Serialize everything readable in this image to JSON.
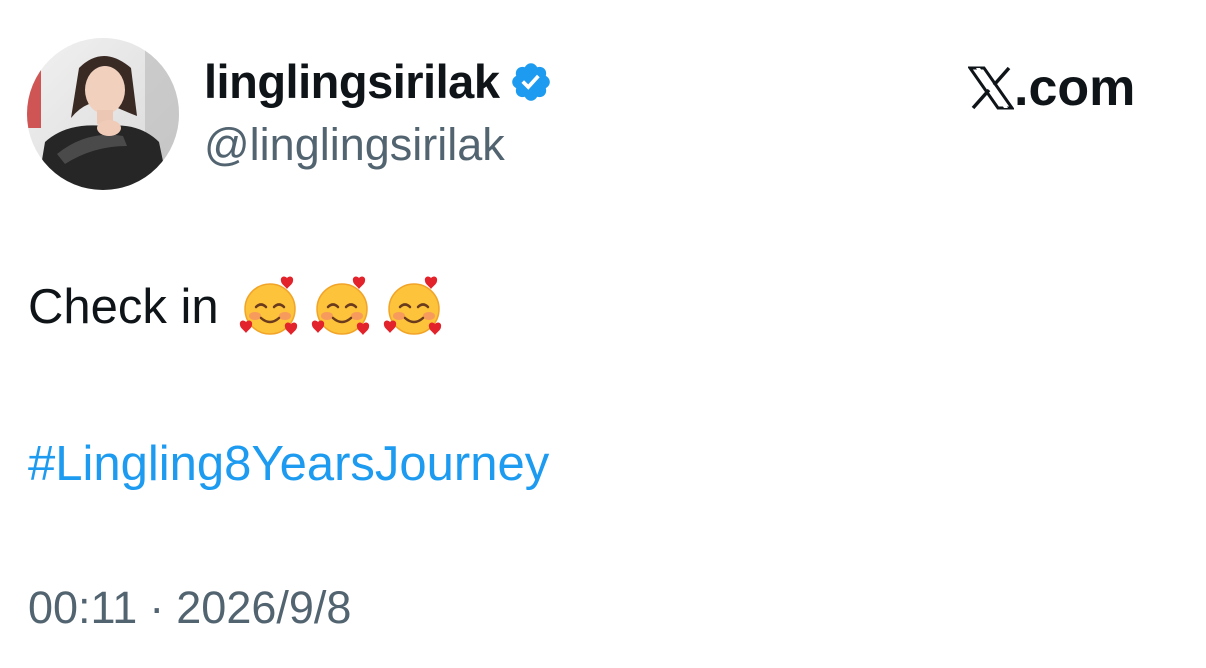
{
  "tweet": {
    "author": {
      "display_name": "linglingsirilak",
      "handle": "@linglingsirilak",
      "verified": true,
      "verified_color": "#1d9bf0"
    },
    "site": {
      "brand_icon": "x-logo-icon",
      "brand_suffix": ".com"
    },
    "text": "Check in",
    "emojis": [
      "smiling-face-with-hearts",
      "smiling-face-with-hearts",
      "smiling-face-with-hearts"
    ],
    "hashtag": "#Lingling8YearsJourney",
    "time": "00:11",
    "separator": "·",
    "date": "2026/9/8"
  },
  "colors": {
    "text_primary": "#0f1419",
    "text_secondary": "#536471",
    "link": "#1d9bf0",
    "background": "#ffffff"
  }
}
